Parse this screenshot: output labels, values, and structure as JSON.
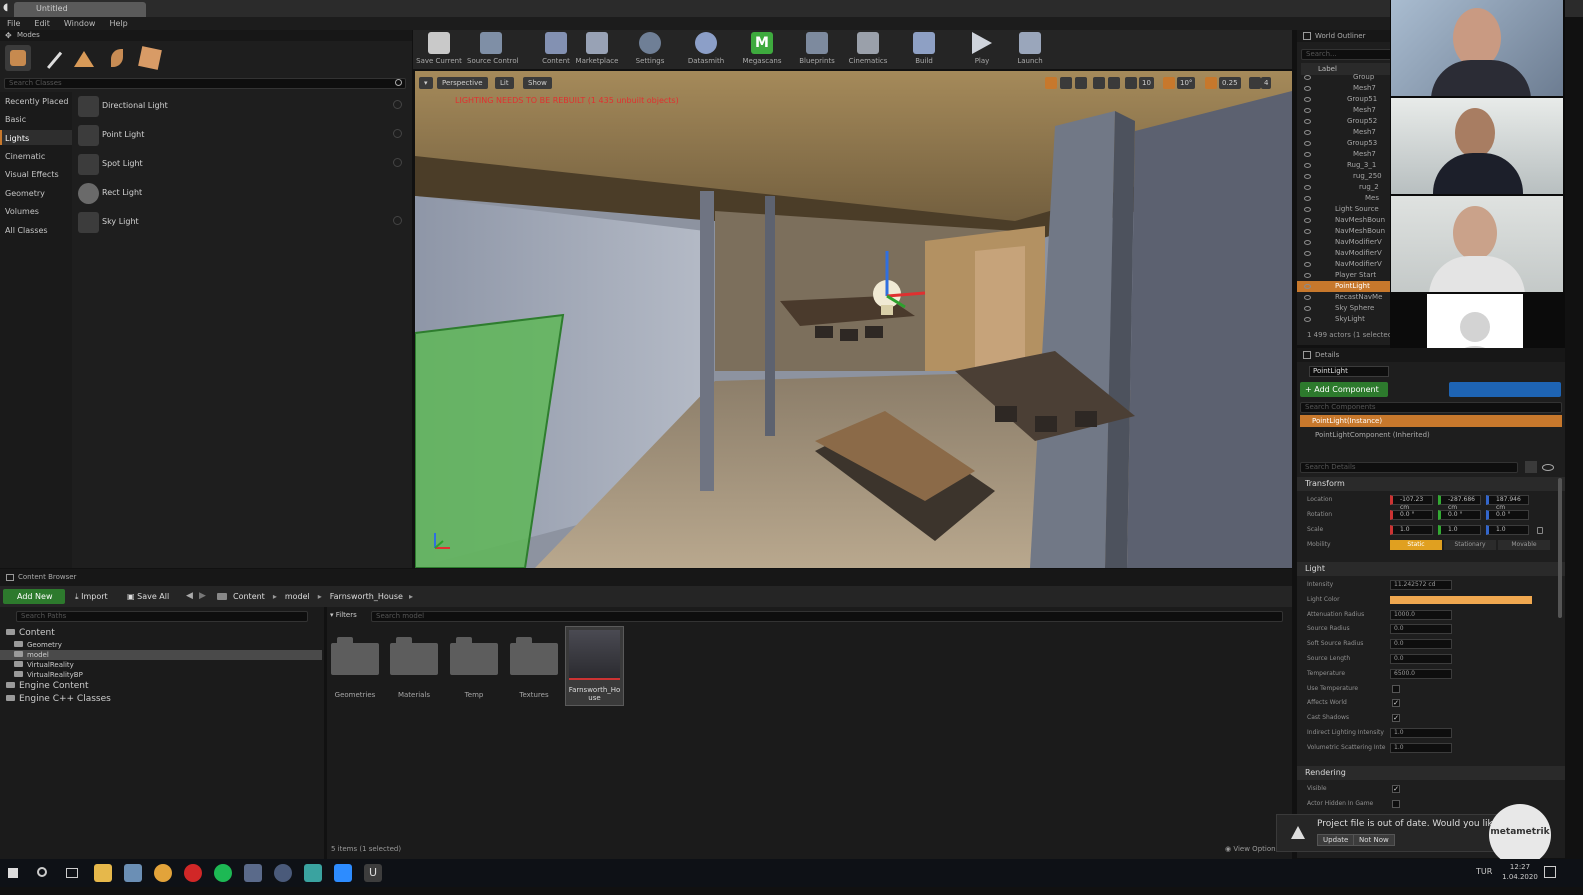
{
  "title_tab": "Untitled",
  "menu": [
    "File",
    "Edit",
    "Window",
    "Help"
  ],
  "modes": {
    "title": "Modes",
    "search_placeholder": "Search Classes",
    "categories": [
      "Recently Placed",
      "Basic",
      "Lights",
      "Cinematic",
      "Visual Effects",
      "Geometry",
      "Volumes",
      "All Classes"
    ],
    "selected_category": "Lights",
    "lights": [
      "Directional Light",
      "Point Light",
      "Spot Light",
      "Rect Light",
      "Sky Light"
    ]
  },
  "toolbar": [
    "Save Current",
    "Source Control",
    "Content",
    "Marketplace",
    "Settings",
    "Datasmith",
    "Megascans",
    "Blueprints",
    "Cinematics",
    "Build",
    "Play",
    "Launch"
  ],
  "viewport": {
    "perspective": "Perspective",
    "lit": "Lit",
    "show": "Show",
    "warning": "LIGHTING NEEDS TO BE REBUILT (1 435 unbuilt objects)",
    "snap_value": "10",
    "angle_value": "10°",
    "scale_value": "0.25",
    "camera_speed": "4"
  },
  "outliner": {
    "title": "World Outliner",
    "search_placeholder": "Search...",
    "label_header": "Label",
    "rows": [
      "Group",
      "Mesh7",
      "Group51",
      "Mesh7",
      "Group52",
      "Mesh7",
      "Group53",
      "Mesh7",
      "Rug_3_1",
      "rug_250",
      "rug_2",
      "Mes",
      "Light Source",
      "NavMeshBoun",
      "NavMeshBoun",
      "NavModifierV",
      "NavModifierV",
      "NavModifierV",
      "Player Start",
      "PointLight",
      "RecastNavMe",
      "Sky Sphere",
      "SkyLight"
    ],
    "selected": "PointLight",
    "footer": "1 499 actors (1 selected)"
  },
  "details": {
    "title": "Details",
    "name": "PointLight",
    "add_component": "+ Add Component",
    "search_components": "Search Components",
    "instance": "PointLight(Instance)",
    "component": "PointLightComponent (Inherited)",
    "search_details": "Search Details",
    "transform": {
      "header": "Transform",
      "location_label": "Location",
      "location": [
        "-107.23 cm",
        "-287.686 cm",
        "187.946 cm"
      ],
      "rotation_label": "Rotation",
      "rotation": [
        "0.0 °",
        "0.0 °",
        "0.0 °"
      ],
      "scale_label": "Scale",
      "scale": [
        "1.0",
        "1.0",
        "1.0"
      ],
      "mobility_label": "Mobility",
      "mobility": [
        "Static",
        "Stationary",
        "Movable"
      ]
    },
    "light": {
      "header": "Light",
      "rows": [
        {
          "label": "Intensity",
          "value": "11.242572 cd"
        },
        {
          "label": "Light Color",
          "value": ""
        },
        {
          "label": "Attenuation Radius",
          "value": "1000.0"
        },
        {
          "label": "Source Radius",
          "value": "0.0"
        },
        {
          "label": "Soft Source Radius",
          "value": "0.0"
        },
        {
          "label": "Source Length",
          "value": "0.0"
        },
        {
          "label": "Temperature",
          "value": "6500.0"
        },
        {
          "label": "Use Temperature",
          "value": ""
        },
        {
          "label": "Affects World",
          "value": "✓"
        },
        {
          "label": "Cast Shadows",
          "value": "✓"
        },
        {
          "label": "Indirect Lighting Intensity",
          "value": "1.0"
        },
        {
          "label": "Volumetric Scattering Inte",
          "value": "1.0"
        }
      ]
    },
    "rendering": {
      "header": "Rendering",
      "rows": [
        {
          "label": "Visible",
          "value": "✓"
        },
        {
          "label": "Actor Hidden In Game",
          "value": ""
        }
      ]
    }
  },
  "content_browser": {
    "tab": "Content Browser",
    "add_new": "Add New",
    "import": "Import",
    "save_all": "Save All",
    "path": [
      "Content",
      "model",
      "Farnsworth_House"
    ],
    "search_paths": "Search Paths",
    "filters": "Filters",
    "search_assets": "Search model",
    "tree": [
      {
        "label": "Content",
        "indent": 0,
        "big": true
      },
      {
        "label": "Geometry",
        "indent": 1,
        "big": false
      },
      {
        "label": "model",
        "indent": 1,
        "big": false,
        "selected": true
      },
      {
        "label": "VirtualReality",
        "indent": 1,
        "big": false
      },
      {
        "label": "VirtualRealityBP",
        "indent": 1,
        "big": false
      },
      {
        "label": "Engine Content",
        "indent": 0,
        "big": true
      },
      {
        "label": "Engine C++ Classes",
        "indent": 0,
        "big": true
      }
    ],
    "assets": [
      "Geometries",
      "Materials",
      "Temp",
      "Textures"
    ],
    "selected_asset": "Farnsworth_House",
    "status": "5 items (1 selected)",
    "view_options": "View Options"
  },
  "notification": {
    "text": "Project file is out of date. Would you like",
    "update": "Update",
    "not_now": "Not Now"
  },
  "watermark": "metametrik",
  "taskbar": {
    "lang": "TUR",
    "time": "12:27",
    "date": "1.04.2020"
  },
  "colors": {
    "selection": "#c7782c",
    "add_component": "#2d7a2d",
    "light_color": "#f0a850",
    "warning": "#e03030"
  }
}
